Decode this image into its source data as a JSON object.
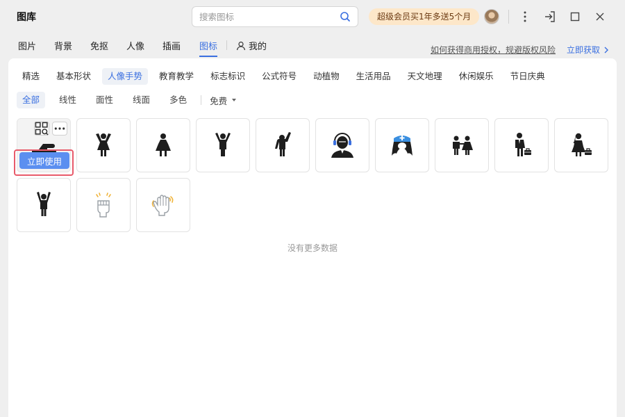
{
  "app": {
    "title": "图库"
  },
  "search": {
    "placeholder": "搜索图标",
    "value": ""
  },
  "promo": {
    "label": "超级会员买1年多送5个月"
  },
  "nav": {
    "items": [
      {
        "label": "图片",
        "active": false
      },
      {
        "label": "背景",
        "active": false
      },
      {
        "label": "免抠",
        "active": false
      },
      {
        "label": "人像",
        "active": false
      },
      {
        "label": "插画",
        "active": false
      },
      {
        "label": "图标",
        "active": true
      }
    ],
    "mine": "我的",
    "license_link": "如何获得商用授权，规避版权风险",
    "get_now": "立即获取"
  },
  "categories": [
    "精选",
    "基本形状",
    "人像手势",
    "教育教学",
    "标志标识",
    "公式符号",
    "动植物",
    "生活用品",
    "天文地理",
    "休闲娱乐",
    "节日庆典"
  ],
  "active_category": "人像手势",
  "filters": [
    "全部",
    "线性",
    "面性",
    "线面",
    "多色"
  ],
  "active_filter": "全部",
  "price_filter": "免费",
  "hover_tile": {
    "use_label": "立即使用"
  },
  "icons": [
    "thumbs-up-hand-icon",
    "girl-raising-arms-icon",
    "girl-standing-icon",
    "boy-raising-arms-icon",
    "person-waving-icon",
    "headset-agent-icon",
    "nurse-icon",
    "boy-and-girl-icon",
    "businessman-with-briefcase-icon",
    "businesswoman-with-briefcase-icon",
    "person-arms-up-icon",
    "raised-fist-icon",
    "waving-hand-icon"
  ],
  "empty_text": "没有更多数据",
  "colors": {
    "accent": "#3a6fe0",
    "use_button": "#5b8ff0",
    "highlight_frame": "#e85a6a",
    "promo_bg": "#fde7c9"
  }
}
